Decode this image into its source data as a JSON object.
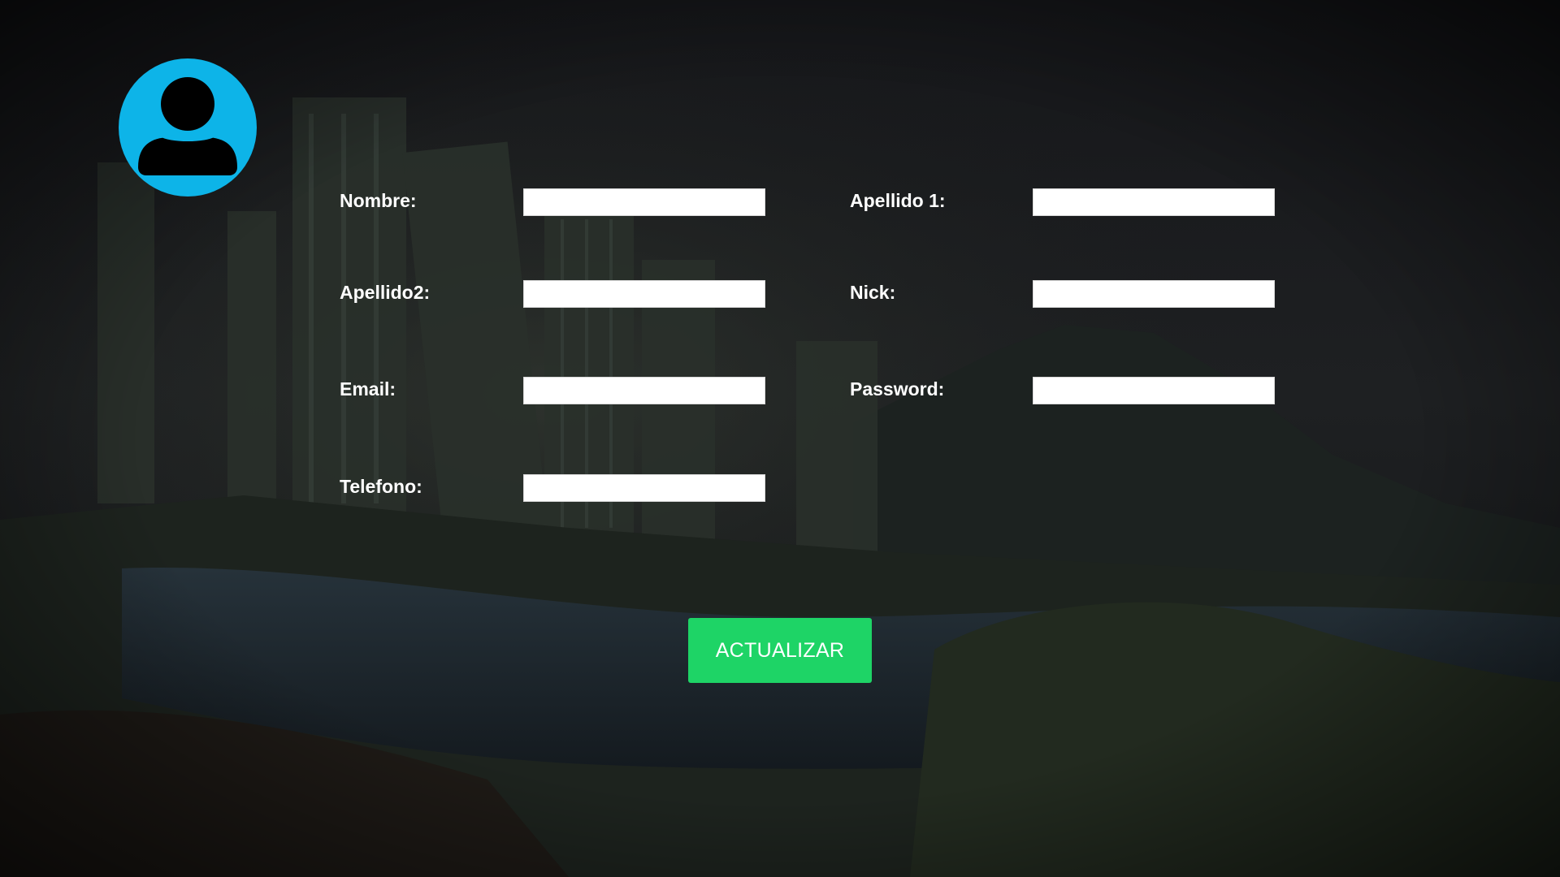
{
  "colors": {
    "avatar_bg": "#0db4e8",
    "avatar_fg": "#000000",
    "button_bg": "#1ed466",
    "label_text": "#ffffff",
    "input_bg": "#ffffff"
  },
  "profile": {
    "avatar_icon": "user-icon"
  },
  "form": {
    "nombre": {
      "label": "Nombre:",
      "value": ""
    },
    "apellido1": {
      "label": "Apellido 1:",
      "value": ""
    },
    "apellido2": {
      "label": "Apellido2:",
      "value": ""
    },
    "nick": {
      "label": "Nick:",
      "value": ""
    },
    "email": {
      "label": "Email:",
      "value": ""
    },
    "password": {
      "label": "Password:",
      "value": ""
    },
    "telefono": {
      "label": "Telefono:",
      "value": ""
    }
  },
  "actions": {
    "update_label": "ACTUALIZAR"
  }
}
